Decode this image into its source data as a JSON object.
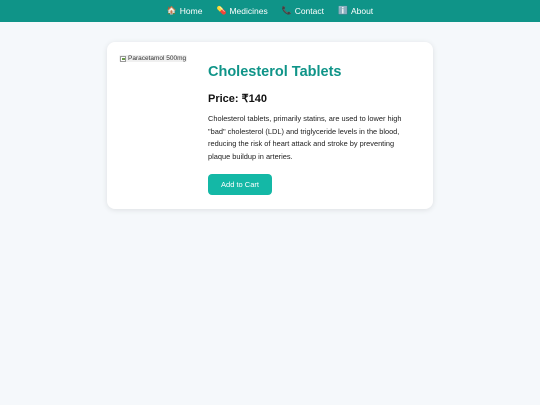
{
  "nav": {
    "items": [
      {
        "icon": "home-icon",
        "glyph": "🏠",
        "label": "Home"
      },
      {
        "icon": "pill-icon",
        "glyph": "💊",
        "label": "Medicines"
      },
      {
        "icon": "phone-icon",
        "glyph": "📞",
        "label": "Contact"
      },
      {
        "icon": "info-icon",
        "glyph": "ℹ️",
        "label": "About"
      }
    ]
  },
  "product": {
    "image_alt": "Paracetamol 500mg",
    "title": "Cholesterol Tablets",
    "price": "Price: ₹140",
    "description": "Cholesterol tablets, primarily statins, are used to lower high \"bad\" cholesterol (LDL) and triglyceride levels in the blood, reducing the risk of heart attack and stroke by preventing plaque buildup in arteries.",
    "add_to_cart_label": "Add to Cart"
  },
  "colors": {
    "brand": "#0f9488",
    "button": "#14b8a6",
    "background": "#f5f8fb"
  }
}
